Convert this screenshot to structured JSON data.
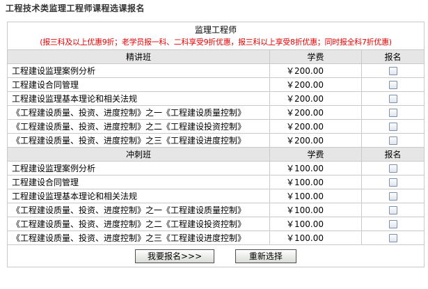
{
  "page_title": "工程技术类监理工程师课程选课报名",
  "caption": {
    "title": "监理工程师",
    "discount_note": "(报三科及以上优惠9折；老学员报一科、二科享受9折优惠，报三科以上享受8折优惠；同时报全科7折优惠)"
  },
  "sections": [
    {
      "name": "精讲班",
      "fee_label": "学费",
      "signup_label": "报名",
      "courses": [
        {
          "name": "工程建设监理案例分析",
          "price": "￥200.00"
        },
        {
          "name": "工程建设合同管理",
          "price": "￥200.00"
        },
        {
          "name": "工程建设监理基本理论和相关法规",
          "price": "￥200.00"
        },
        {
          "name": "《工程建设质量、投资、进度控制》之一《工程建设质量控制》",
          "price": "￥200.00"
        },
        {
          "name": "《工程建设质量、投资、进度控制》之二《工程建设投资控制》",
          "price": "￥200.00"
        },
        {
          "name": "《工程建设质量、投资、进度控制》之三《工程建设进度控制》",
          "price": "￥200.00"
        }
      ]
    },
    {
      "name": "冲刺班",
      "fee_label": "学费",
      "signup_label": "报名",
      "courses": [
        {
          "name": "工程建设监理案例分析",
          "price": "￥100.00"
        },
        {
          "name": "工程建设合同管理",
          "price": "￥100.00"
        },
        {
          "name": "工程建设监理基本理论和相关法规",
          "price": "￥100.00"
        },
        {
          "name": "《工程建设质量、投资、进度控制》之一《工程建设质量控制》",
          "price": "￥100.00"
        },
        {
          "name": "《工程建设质量、投资、进度控制》之二《工程建设投资控制》",
          "price": "￥100.00"
        },
        {
          "name": "《工程建设质量、投资、进度控制》之三《工程建设进度控制》",
          "price": "￥100.00"
        }
      ]
    }
  ],
  "buttons": {
    "submit_label": "我要报名>>>",
    "reset_label": "重新选择"
  }
}
